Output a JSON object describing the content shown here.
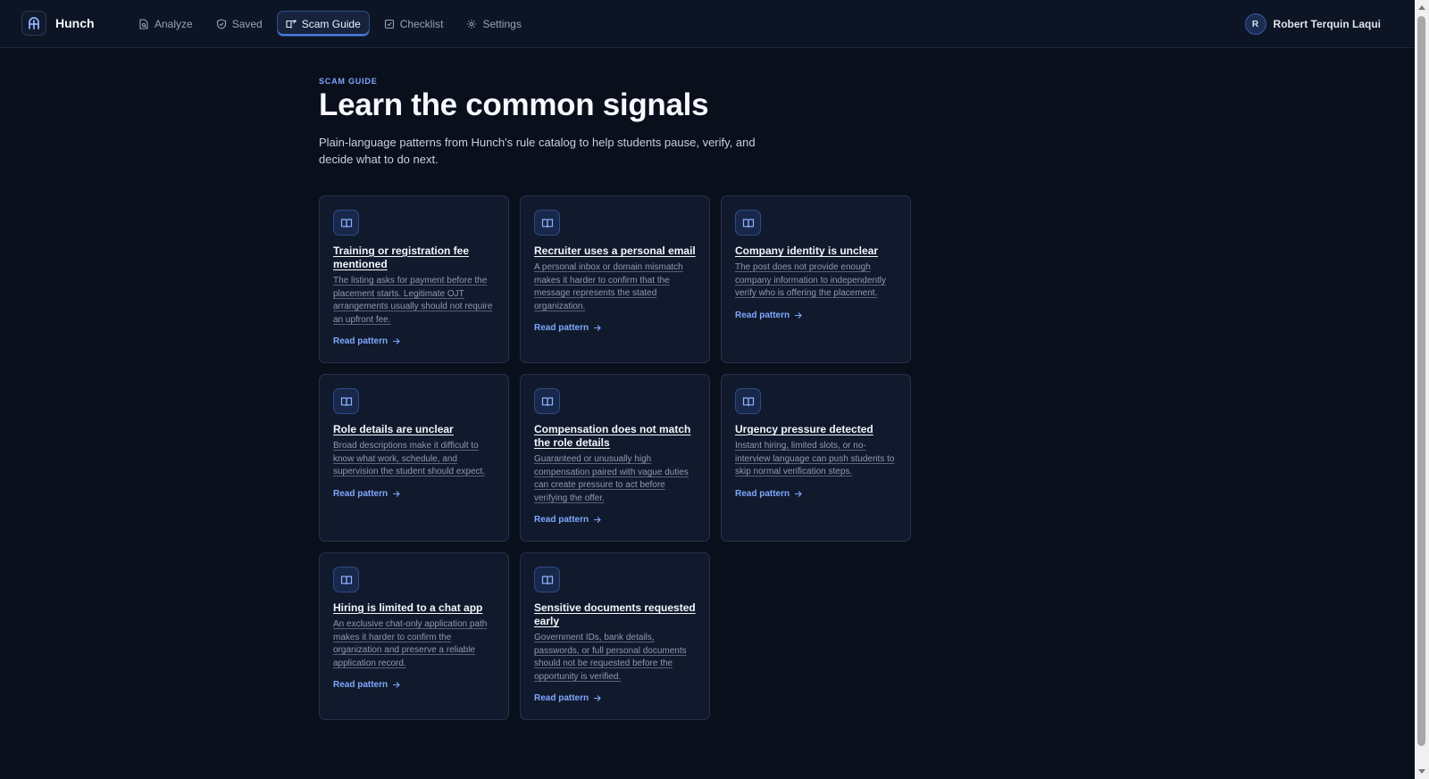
{
  "app": {
    "name": "Hunch"
  },
  "nav": [
    {
      "label": "Analyze",
      "icon": "document-search-icon",
      "active": false
    },
    {
      "label": "Saved",
      "icon": "shield-check-icon",
      "active": false
    },
    {
      "label": "Scam Guide",
      "icon": "book-open-icon",
      "active": true
    },
    {
      "label": "Checklist",
      "icon": "checkbox-icon",
      "active": false
    },
    {
      "label": "Settings",
      "icon": "gear-icon",
      "active": false
    }
  ],
  "user": {
    "initial": "R",
    "name": "Robert Terquin Laqui"
  },
  "header": {
    "eyebrow": "SCAM GUIDE",
    "title": "Learn the common signals",
    "subtitle": "Plain-language patterns from Hunch's rule catalog to help students pause, verify, and decide what to do next."
  },
  "cards": [
    {
      "title": "Training or registration fee mentioned",
      "description": "The listing asks for payment before the placement starts. Legitimate OJT arrangements usually should not require an upfront fee.",
      "link": "Read pattern"
    },
    {
      "title": "Recruiter uses a personal email",
      "description": "A personal inbox or domain mismatch makes it harder to confirm that the message represents the stated organization.",
      "link": "Read pattern"
    },
    {
      "title": "Company identity is unclear",
      "description": "The post does not provide enough company information to independently verify who is offering the placement.",
      "link": "Read pattern"
    },
    {
      "title": "Role details are unclear",
      "description": "Broad descriptions make it difficult to know what work, schedule, and supervision the student should expect.",
      "link": "Read pattern"
    },
    {
      "title": "Compensation does not match the role details",
      "description": "Guaranteed or unusually high compensation paired with vague duties can create pressure to act before verifying the offer.",
      "link": "Read pattern"
    },
    {
      "title": "Urgency pressure detected",
      "description": "Instant hiring, limited slots, or no-interview language can push students to skip normal verification steps.",
      "link": "Read pattern"
    },
    {
      "title": "Hiring is limited to a chat app",
      "description": "An exclusive chat-only application path makes it harder to confirm the organization and preserve a reliable application record.",
      "link": "Read pattern"
    },
    {
      "title": "Sensitive documents requested early",
      "description": "Government IDs, bank details, passwords, or full personal documents should not be requested before the opportunity is verified.",
      "link": "Read pattern"
    }
  ],
  "colors": {
    "background": "#0a0f1c",
    "card": "#111a2c",
    "accent": "#7fa7ff",
    "active_border": "#2e4a84"
  }
}
